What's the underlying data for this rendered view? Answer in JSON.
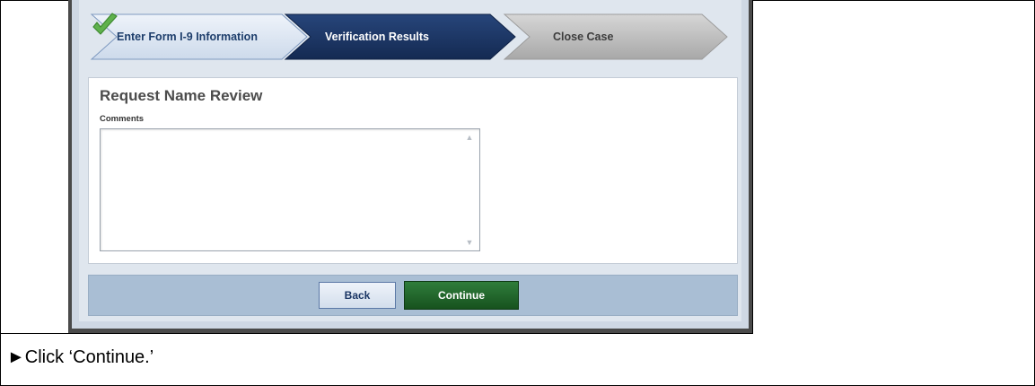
{
  "steps": [
    {
      "label": "Enter Form I-9 Information",
      "state": "complete"
    },
    {
      "label": "Verification Results",
      "state": "current"
    },
    {
      "label": "Close Case",
      "state": "upcoming"
    }
  ],
  "panel": {
    "title": "Request Name Review",
    "comments_label": "Comments",
    "comments_value": ""
  },
  "buttons": {
    "back": "Back",
    "continue": "Continue"
  },
  "instruction": "►Click ‘Continue.’",
  "colors": {
    "step_complete": "#dde6f3",
    "step_current": "#1c335f",
    "step_upcoming": "#bdbdbd",
    "continue_bg": "#1f6a2b",
    "button_bar": "#a9bed4",
    "check": "#5fb14c"
  }
}
